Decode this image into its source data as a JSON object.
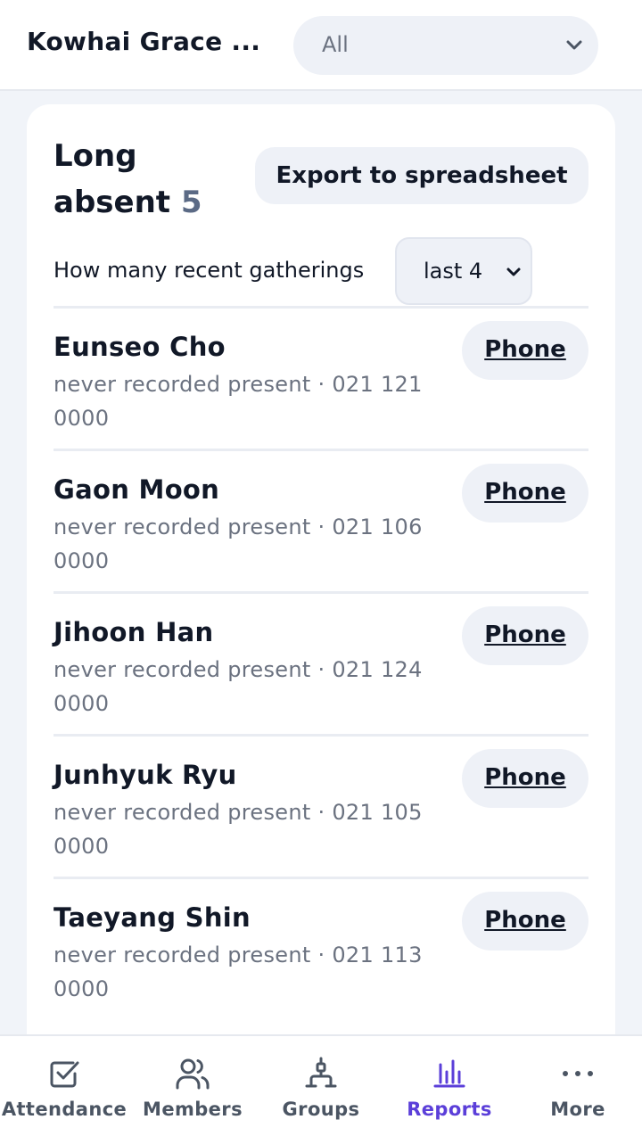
{
  "header": {
    "org_name": "Kowhai Grace ...",
    "filter_value": "All"
  },
  "report": {
    "title_line1": "Long",
    "title_line2": "absent",
    "count": "5",
    "export_label": "Export to spreadsheet",
    "gatherings_label": "How many recent gatherings",
    "gatherings_value": "last 4"
  },
  "members": [
    {
      "name": "Eunseo Cho",
      "detail": "never recorded present · 021 121 0000",
      "action": "Phone"
    },
    {
      "name": "Gaon Moon",
      "detail": "never recorded present · 021 106 0000",
      "action": "Phone"
    },
    {
      "name": "Jihoon Han",
      "detail": "never recorded present · 021 124 0000",
      "action": "Phone"
    },
    {
      "name": "Junhyuk Ryu",
      "detail": "never recorded present · 021 105 0000",
      "action": "Phone"
    },
    {
      "name": "Taeyang Shin",
      "detail": "never recorded present · 021 113 0000",
      "action": "Phone"
    }
  ],
  "nav": {
    "items": [
      {
        "label": "Attendance",
        "icon": "checkbox-icon"
      },
      {
        "label": "Members",
        "icon": "members-icon"
      },
      {
        "label": "Groups",
        "icon": "groups-icon"
      },
      {
        "label": "Reports",
        "icon": "bar-chart-icon"
      },
      {
        "label": "More",
        "icon": "more-dots-icon"
      }
    ],
    "active_index": 3
  },
  "colors": {
    "accent": "#5b3fd9",
    "pill_bg": "#eef1f7",
    "page_bg": "#f1f4f9",
    "muted_text": "#6b7280"
  }
}
